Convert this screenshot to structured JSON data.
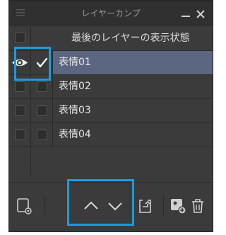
{
  "panel": {
    "title": "レイヤーカンプ",
    "header_label": "最後のレイヤーの表示状態"
  },
  "rows": [
    {
      "name": "表情01",
      "visible": true,
      "checked": true,
      "selected": true
    },
    {
      "name": "表情02",
      "visible": false,
      "checked": false,
      "selected": false
    },
    {
      "name": "表情03",
      "visible": false,
      "checked": false,
      "selected": false
    },
    {
      "name": "表情04",
      "visible": false,
      "checked": false,
      "selected": false
    }
  ],
  "toolbar": {
    "buttons": [
      "new-comp-icon",
      "move-up-icon",
      "move-down-icon",
      "update-comp-icon",
      "create-layer-icon",
      "trash-icon"
    ]
  },
  "colors": {
    "panel_bg": "#3b3b3b",
    "selection": "#5d6680",
    "highlight": "#1e9ad6"
  }
}
